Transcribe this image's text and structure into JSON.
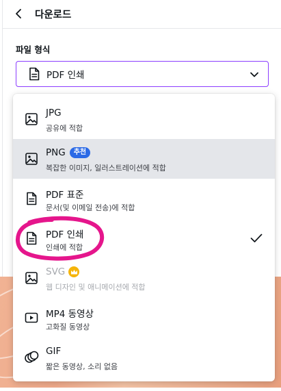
{
  "header": {
    "title": "다운로드"
  },
  "file_format": {
    "section_label": "파일 형식",
    "selected_label": "PDF 인쇄"
  },
  "options": [
    {
      "name": "JPG",
      "desc": "공유에 적합",
      "icon": "image-icon"
    },
    {
      "name": "PNG",
      "badge": "추천",
      "desc": "복잡한 이미지, 일러스트레이션에 적합",
      "icon": "image-icon",
      "highlighted": true
    },
    {
      "name": "PDF 표준",
      "desc": "문서(및 이메일 전송)에 적합",
      "icon": "document-icon"
    },
    {
      "name": "PDF 인쇄",
      "desc": "인쇄에 적합",
      "icon": "document-icon",
      "selected": true
    },
    {
      "name": "SVG",
      "desc": "웹 디자인 및 애니메이션에 적합",
      "icon": "image-icon",
      "premium": true,
      "disabled": true
    },
    {
      "name": "MP4 동영상",
      "desc": "고화질 동영상",
      "icon": "video-icon"
    },
    {
      "name": "GIF",
      "desc": "짧은 동영상, 소리 없음",
      "icon": "gif-icon"
    }
  ],
  "colors": {
    "accent": "#8b3dff",
    "badge": "#2b6ae6",
    "highlight_row": "#e4e6ea",
    "annotation": "#e5168c",
    "crown": "#f5b40a"
  }
}
